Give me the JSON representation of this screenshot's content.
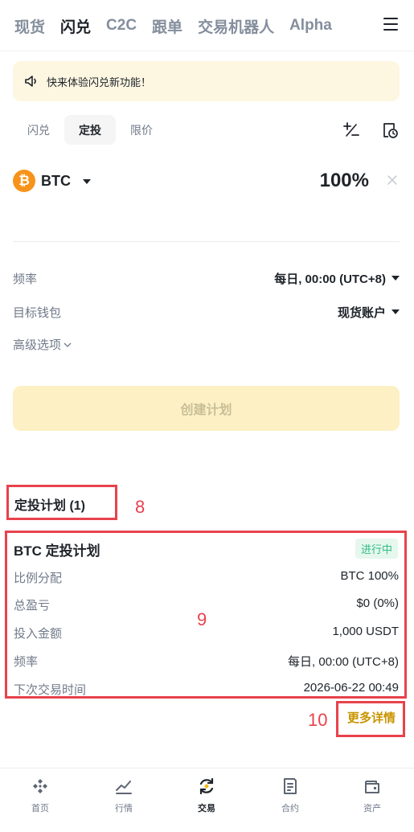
{
  "top_nav": {
    "items": [
      "现货",
      "闪兑",
      "C2C",
      "跟单",
      "交易机器人",
      "Alpha"
    ],
    "active_index": 1,
    "menu_icon": "hamburger-icon"
  },
  "notice": {
    "icon": "speaker-icon",
    "text": "快来体验闪兑新功能！"
  },
  "sub_tabs": {
    "items": [
      "闪兑",
      "定投",
      "限价"
    ],
    "active_index": 1
  },
  "tools": {
    "icons": [
      "plus-minus-icon",
      "clock-history-icon"
    ]
  },
  "asset": {
    "icon_glyph": "₿",
    "name": "BTC",
    "percent": "100%"
  },
  "settings": {
    "frequency_label": "频率",
    "frequency_value": "每日, 00:00 (UTC+8)",
    "wallet_label": "目标钱包",
    "wallet_value": "现货账户",
    "advanced_label": "高级选项"
  },
  "create_button": {
    "label": "创建计划",
    "enabled": false
  },
  "annotations": [
    "8",
    "9",
    "10"
  ],
  "plans": {
    "title": "定投计划 (1)",
    "card": {
      "title": "BTC 定投计划",
      "status": "进行中",
      "rows": [
        {
          "label": "比例分配",
          "value": "BTC 100%"
        },
        {
          "label": "总盈亏",
          "value": "$0 (0%)"
        },
        {
          "label": "投入金额",
          "value": "1,000 USDT"
        },
        {
          "label": "频率",
          "value": "每日, 00:00 (UTC+8)"
        },
        {
          "label": "下次交易时间",
          "value": "2026-06-22 00:49"
        }
      ]
    },
    "more_label": "更多详情"
  },
  "bottom_tabs": {
    "items": [
      {
        "label": "首页",
        "icon": "home-icon"
      },
      {
        "label": "行情",
        "icon": "chart-icon"
      },
      {
        "label": "交易",
        "icon": "trade-icon"
      },
      {
        "label": "合约",
        "icon": "futures-icon"
      },
      {
        "label": "资产",
        "icon": "wallet-icon"
      }
    ],
    "active_index": 2
  },
  "colors": {
    "accent": "#f0b90b",
    "annotation": "#e8424c",
    "status_green": "#2ebd85",
    "link": "#c99400"
  }
}
